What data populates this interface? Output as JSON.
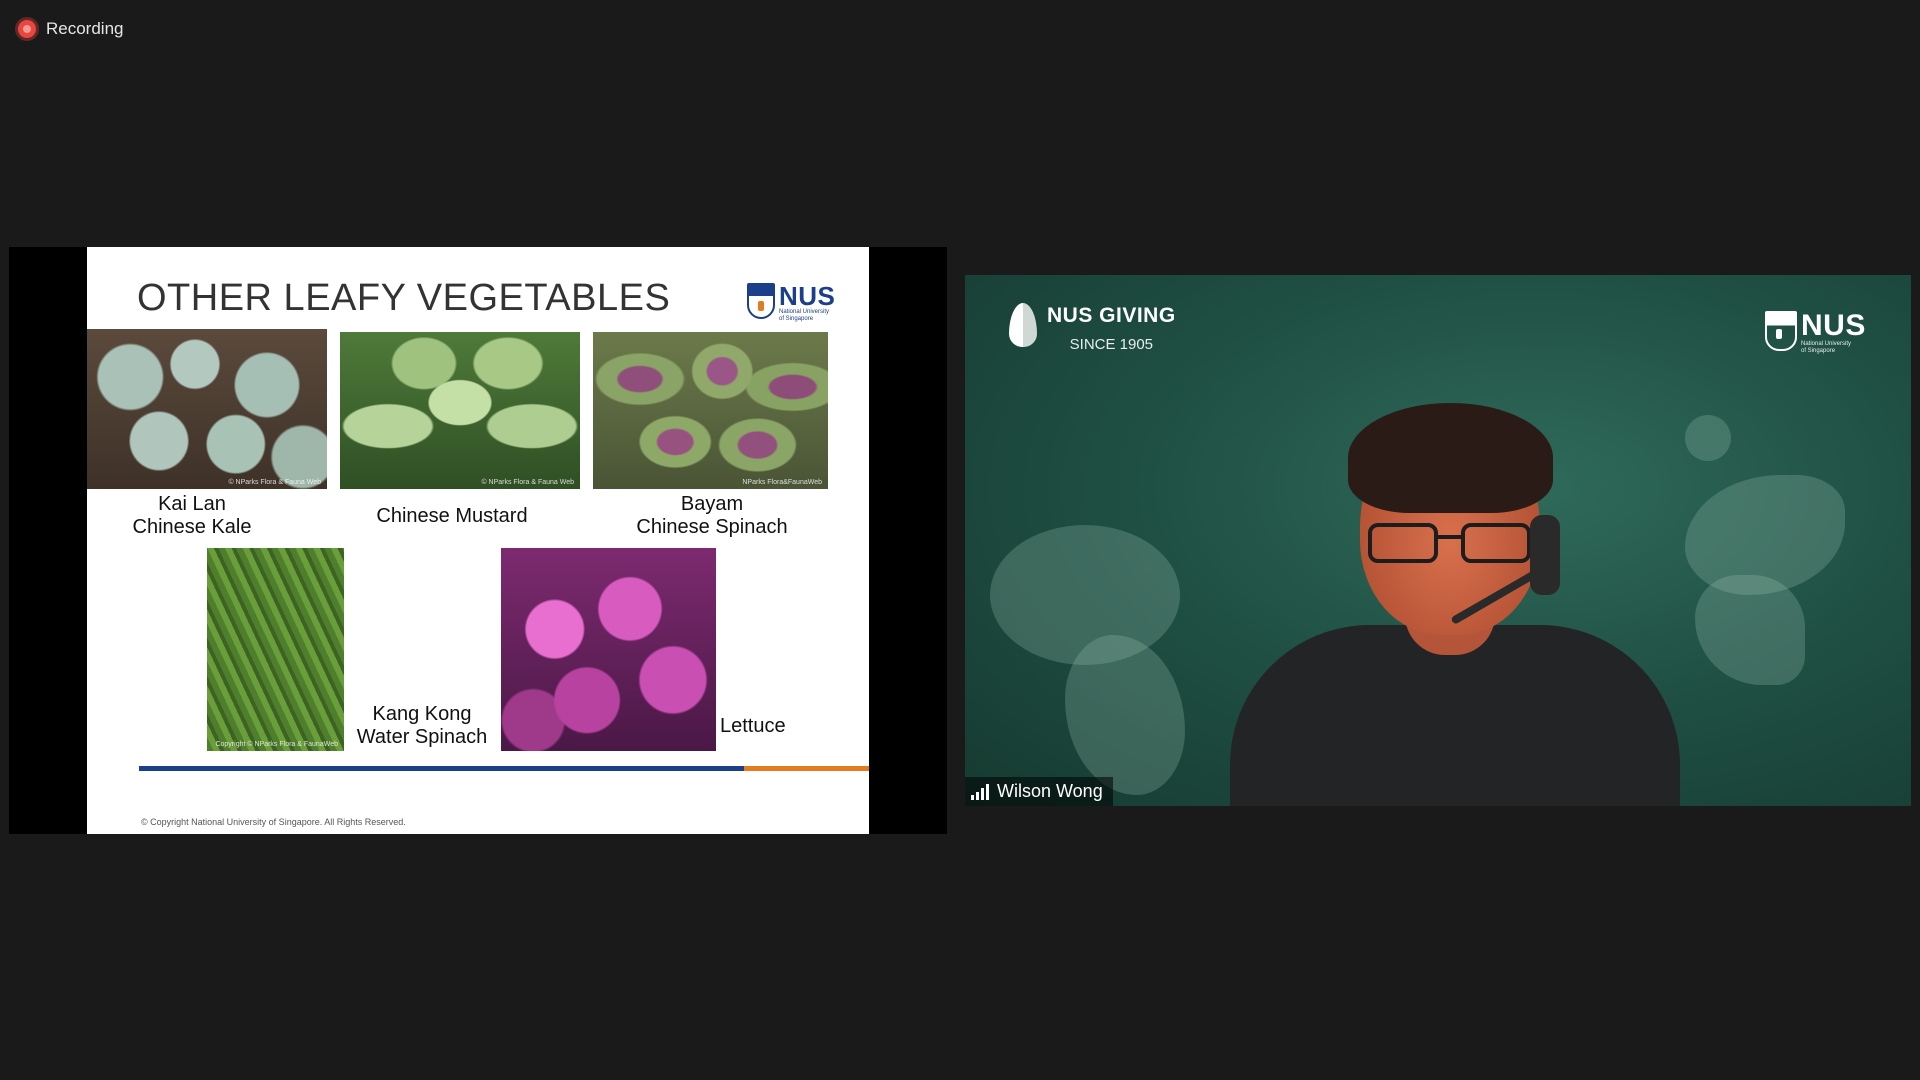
{
  "recording": {
    "label": "Recording"
  },
  "slide": {
    "title": "OTHER LEAFY VEGETABLES",
    "logo": {
      "name": "NUS",
      "subtitle_line1": "National University",
      "subtitle_line2": "of Singapore"
    },
    "vegetables": [
      {
        "line1": "Kai Lan",
        "line2": "Chinese Kale",
        "credit": "© NParks Flora & Fauna Web"
      },
      {
        "line1": "Chinese Mustard",
        "line2": "",
        "credit": "© NParks Flora & Fauna Web"
      },
      {
        "line1": "Bayam",
        "line2": "Chinese Spinach",
        "credit": "NParks Flora&FaunaWeb"
      },
      {
        "line1": "Kang Kong",
        "line2": "Water Spinach",
        "credit": "Copyright © NParks Flora & FaunaWeb"
      },
      {
        "line1": "Lettuce",
        "line2": "",
        "credit": ""
      }
    ],
    "copyright": "© Copyright National University of Singapore. All Rights Reserved."
  },
  "video": {
    "background": {
      "brand": "NUS GIVING",
      "since": "SINCE 1905",
      "logo": {
        "name": "NUS",
        "subtitle_line1": "National University",
        "subtitle_line2": "of Singapore"
      }
    },
    "participant_name": "Wilson Wong"
  },
  "colors": {
    "nus_blue": "#1c3f8a",
    "nus_orange": "#e37b1f",
    "recording_red": "#e8463f",
    "meeting_bg": "#1a1a1a"
  }
}
